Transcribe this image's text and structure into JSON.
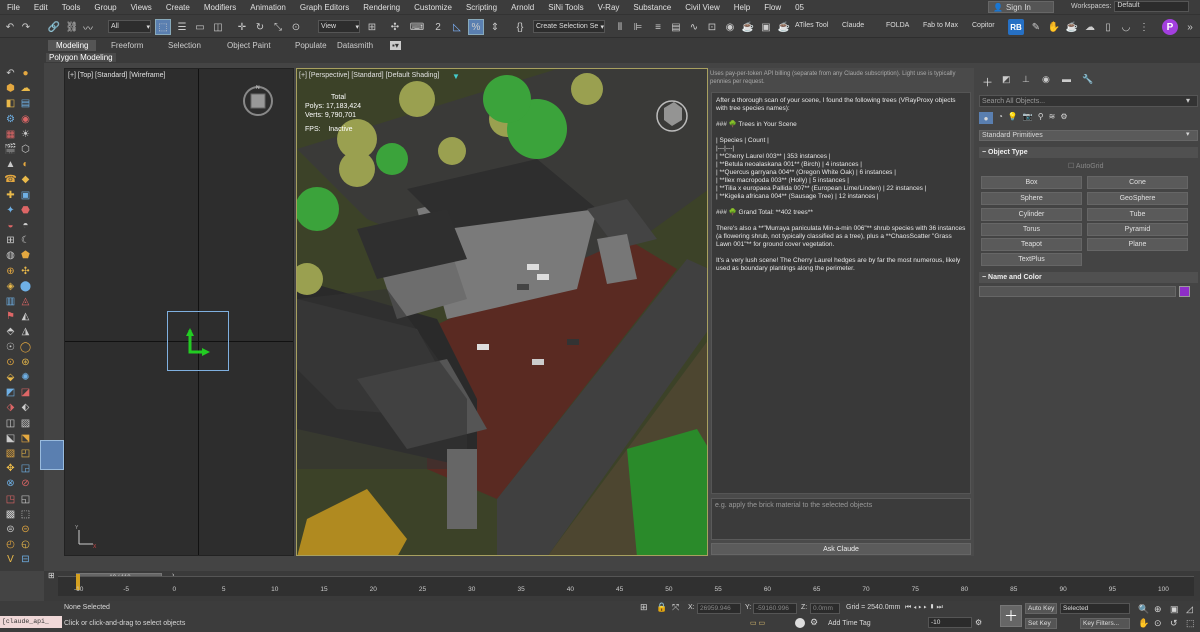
{
  "menu": [
    "File",
    "Edit",
    "Tools",
    "Group",
    "Views",
    "Create",
    "Modifiers",
    "Animation",
    "Graph Editors",
    "Rendering",
    "Customize",
    "Scripting",
    "Arnold",
    "SiNi Tools",
    "V-Ray",
    "Substance",
    "Civil View",
    "Help",
    "Flow",
    "05"
  ],
  "signin": {
    "label": "Sign In"
  },
  "workspace": {
    "label": "Workspaces:",
    "value": "Default"
  },
  "toolbar": {
    "filter_value": "All",
    "refcoord_value": "View",
    "selection_set_placeholder": "Create Selection Se",
    "plugins": [
      "ATiles Tool",
      "Claude",
      "FOLDA",
      "Fab to Max",
      "Copitor"
    ]
  },
  "ribbon": {
    "tabs": [
      "Modeling",
      "Freeform",
      "Selection",
      "Object Paint",
      "Populate",
      "Datasmith"
    ],
    "mode": "Polygon Modeling"
  },
  "viewport_top": {
    "label": "[+] [Top] [Standard] [Wireframe]"
  },
  "viewport_persp": {
    "label": "[+] [Perspective] [Standard] [Default Shading]",
    "stats_total": "Total",
    "polys_label": "Polys:",
    "polys": "17,183,424",
    "verts_label": "Verts:",
    "verts": "9,790,701",
    "fps_label": "FPS:",
    "fps": "Inactive"
  },
  "claude": {
    "note": "Uses pay-per-token API billing (separate from any Claude subscription). Light use is typically pennies per request.",
    "response": "After a thorough scan of your scene, I found the following trees (VRayProxy objects with tree species names):\n\n### 🌳 Trees in Your Scene\n\n| Species | Count |\n|---|---|\n| **Cherry Laurel 003** | 353 instances |\n| **Betula neoalaskana 001** (Birch) | 4 instances |\n| **Quercus garryana 004** (Oregon White Oak) | 6 instances |\n| **Ilex macropoda 003** (Holly) | 5 instances |\n| **Tilia x europaea Pallida 007** (European Lime/Linden) | 22 instances |\n| **Kigelia africana 004** (Sausage Tree) | 12 instances |\n\n### 🌳 Grand Total: **402 trees**\n\nThere's also a **\"Murraya paniculata Min-a-min 006\"** shrub species with 36 instances (a flowering shrub, not typically classified as a tree), plus a **ChaosScatter \"Grass Lawn 001\"** for ground cover vegetation.\n\nIt's a very lush scene! The Cherry Laurel hedges are by far the most numerous, likely used as boundary plantings along the perimeter.",
    "input_placeholder": "e.g. apply the brick material to the selected objects",
    "ask_label": "Ask Claude"
  },
  "command_panel": {
    "search_placeholder": "Search All Objects...",
    "category": "Standard Primitives",
    "object_type_title": "Object Type",
    "autogrid": "AutoGrid",
    "buttons": [
      "Box",
      "Cone",
      "Sphere",
      "GeoSphere",
      "Cylinder",
      "Tube",
      "Torus",
      "Pyramid",
      "Teapot",
      "Plane",
      "TextPlus"
    ],
    "name_color_title": "Name and Color",
    "color": "#8e2ec8"
  },
  "timeline": {
    "frame": "-10 / 110",
    "ticks": [
      "-10",
      "-5",
      "0",
      "5",
      "10",
      "15",
      "20",
      "25",
      "30",
      "35",
      "40",
      "45",
      "50",
      "55",
      "60",
      "65",
      "70",
      "75",
      "80",
      "85",
      "90",
      "95",
      "100"
    ]
  },
  "status": {
    "script": "[claude_api_",
    "selection": "None Selected",
    "hint": "Click or click-and-drag to select objects",
    "x_label": "X:",
    "x": "26959.946",
    "y_label": "Y:",
    "y": "-59160.996",
    "z_label": "Z:",
    "z": "0.0mm",
    "grid": "Grid = 2540.0mm",
    "add_time_tag": "Add Time Tag",
    "frame_field": "-10",
    "auto_key": "Auto Key",
    "set_key": "Set Key",
    "selected": "Selected",
    "key_filters": "Key Filters..."
  }
}
